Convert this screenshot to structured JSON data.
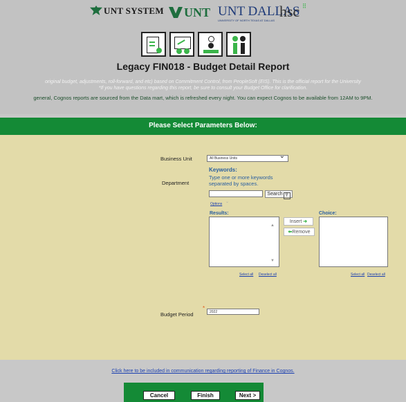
{
  "logos": {
    "unt_system": "UNT SYSTEM",
    "unt": "UNT",
    "unt_dallas": "UNT DALLAS",
    "unt_dallas_sub": "UNIVERSITY OF NORTH TEXAS AT DALLAS",
    "hsc": "hsc"
  },
  "report": {
    "title": "Legacy FIN018 - Budget Detail Report",
    "info_line_1": "original budget, adjustments, roll-forward, and etc) based on Commitment Control, from PeopleSoft (EIS). This is the official report for the University",
    "info_line_2": "*If you have questions regarding this report, be sure to consult your Budget Office for clarification.",
    "info_line_3": "general, Cognos reports are sourced from the Data mart, which is refreshed every night. You can expect Cognos to be available from 12AM to 9PM."
  },
  "params_header": "Please Select Parameters Below:",
  "business_unit": {
    "label": "Business Unit",
    "selected": "All Business Units"
  },
  "department": {
    "label": "Department",
    "keywords_title": "Keywords:",
    "keywords_help": "Type one or more keywords separated by spaces.",
    "search_value": "",
    "search_button": "Search",
    "options_link": "Options",
    "results_label": "Results:",
    "choice_label": "Choice:",
    "insert_button": "Insert",
    "remove_button": "Remove",
    "results_select_all": "Select all",
    "results_deselect_all": "Deselect all",
    "choice_select_all": "Select all",
    "choice_deselect_all": "Deselect all"
  },
  "budget_period": {
    "label": "Budget Period",
    "value": "2022",
    "required_marker": "*"
  },
  "footer_link": "Click here to be included in communication regarding reporting of Finance in Cognos.",
  "buttons": {
    "cancel": "Cancel",
    "finish": "Finish",
    "next": "Next >"
  },
  "colors": {
    "brand_green": "#148a36",
    "panel": "#e3dba9",
    "banner": "#c2c2c2",
    "link": "#1a3fb0"
  }
}
